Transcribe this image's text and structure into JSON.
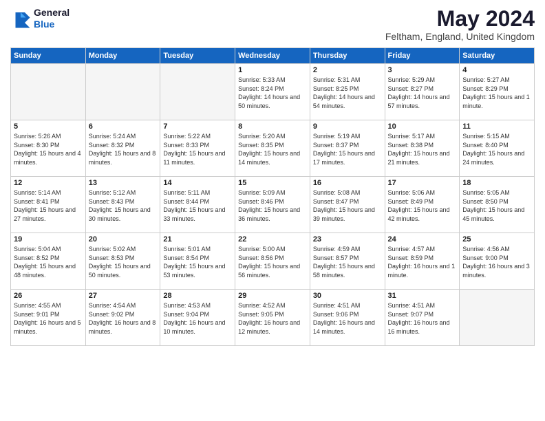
{
  "header": {
    "logo_line1": "General",
    "logo_line2": "Blue",
    "month": "May 2024",
    "location": "Feltham, England, United Kingdom"
  },
  "weekdays": [
    "Sunday",
    "Monday",
    "Tuesday",
    "Wednesday",
    "Thursday",
    "Friday",
    "Saturday"
  ],
  "weeks": [
    [
      {
        "day": "",
        "info": ""
      },
      {
        "day": "",
        "info": ""
      },
      {
        "day": "",
        "info": ""
      },
      {
        "day": "1",
        "info": "Sunrise: 5:33 AM\nSunset: 8:24 PM\nDaylight: 14 hours\nand 50 minutes."
      },
      {
        "day": "2",
        "info": "Sunrise: 5:31 AM\nSunset: 8:25 PM\nDaylight: 14 hours\nand 54 minutes."
      },
      {
        "day": "3",
        "info": "Sunrise: 5:29 AM\nSunset: 8:27 PM\nDaylight: 14 hours\nand 57 minutes."
      },
      {
        "day": "4",
        "info": "Sunrise: 5:27 AM\nSunset: 8:29 PM\nDaylight: 15 hours\nand 1 minute."
      }
    ],
    [
      {
        "day": "5",
        "info": "Sunrise: 5:26 AM\nSunset: 8:30 PM\nDaylight: 15 hours\nand 4 minutes."
      },
      {
        "day": "6",
        "info": "Sunrise: 5:24 AM\nSunset: 8:32 PM\nDaylight: 15 hours\nand 8 minutes."
      },
      {
        "day": "7",
        "info": "Sunrise: 5:22 AM\nSunset: 8:33 PM\nDaylight: 15 hours\nand 11 minutes."
      },
      {
        "day": "8",
        "info": "Sunrise: 5:20 AM\nSunset: 8:35 PM\nDaylight: 15 hours\nand 14 minutes."
      },
      {
        "day": "9",
        "info": "Sunrise: 5:19 AM\nSunset: 8:37 PM\nDaylight: 15 hours\nand 17 minutes."
      },
      {
        "day": "10",
        "info": "Sunrise: 5:17 AM\nSunset: 8:38 PM\nDaylight: 15 hours\nand 21 minutes."
      },
      {
        "day": "11",
        "info": "Sunrise: 5:15 AM\nSunset: 8:40 PM\nDaylight: 15 hours\nand 24 minutes."
      }
    ],
    [
      {
        "day": "12",
        "info": "Sunrise: 5:14 AM\nSunset: 8:41 PM\nDaylight: 15 hours\nand 27 minutes."
      },
      {
        "day": "13",
        "info": "Sunrise: 5:12 AM\nSunset: 8:43 PM\nDaylight: 15 hours\nand 30 minutes."
      },
      {
        "day": "14",
        "info": "Sunrise: 5:11 AM\nSunset: 8:44 PM\nDaylight: 15 hours\nand 33 minutes."
      },
      {
        "day": "15",
        "info": "Sunrise: 5:09 AM\nSunset: 8:46 PM\nDaylight: 15 hours\nand 36 minutes."
      },
      {
        "day": "16",
        "info": "Sunrise: 5:08 AM\nSunset: 8:47 PM\nDaylight: 15 hours\nand 39 minutes."
      },
      {
        "day": "17",
        "info": "Sunrise: 5:06 AM\nSunset: 8:49 PM\nDaylight: 15 hours\nand 42 minutes."
      },
      {
        "day": "18",
        "info": "Sunrise: 5:05 AM\nSunset: 8:50 PM\nDaylight: 15 hours\nand 45 minutes."
      }
    ],
    [
      {
        "day": "19",
        "info": "Sunrise: 5:04 AM\nSunset: 8:52 PM\nDaylight: 15 hours\nand 48 minutes."
      },
      {
        "day": "20",
        "info": "Sunrise: 5:02 AM\nSunset: 8:53 PM\nDaylight: 15 hours\nand 50 minutes."
      },
      {
        "day": "21",
        "info": "Sunrise: 5:01 AM\nSunset: 8:54 PM\nDaylight: 15 hours\nand 53 minutes."
      },
      {
        "day": "22",
        "info": "Sunrise: 5:00 AM\nSunset: 8:56 PM\nDaylight: 15 hours\nand 56 minutes."
      },
      {
        "day": "23",
        "info": "Sunrise: 4:59 AM\nSunset: 8:57 PM\nDaylight: 15 hours\nand 58 minutes."
      },
      {
        "day": "24",
        "info": "Sunrise: 4:57 AM\nSunset: 8:59 PM\nDaylight: 16 hours\nand 1 minute."
      },
      {
        "day": "25",
        "info": "Sunrise: 4:56 AM\nSunset: 9:00 PM\nDaylight: 16 hours\nand 3 minutes."
      }
    ],
    [
      {
        "day": "26",
        "info": "Sunrise: 4:55 AM\nSunset: 9:01 PM\nDaylight: 16 hours\nand 5 minutes."
      },
      {
        "day": "27",
        "info": "Sunrise: 4:54 AM\nSunset: 9:02 PM\nDaylight: 16 hours\nand 8 minutes."
      },
      {
        "day": "28",
        "info": "Sunrise: 4:53 AM\nSunset: 9:04 PM\nDaylight: 16 hours\nand 10 minutes."
      },
      {
        "day": "29",
        "info": "Sunrise: 4:52 AM\nSunset: 9:05 PM\nDaylight: 16 hours\nand 12 minutes."
      },
      {
        "day": "30",
        "info": "Sunrise: 4:51 AM\nSunset: 9:06 PM\nDaylight: 16 hours\nand 14 minutes."
      },
      {
        "day": "31",
        "info": "Sunrise: 4:51 AM\nSunset: 9:07 PM\nDaylight: 16 hours\nand 16 minutes."
      },
      {
        "day": "",
        "info": ""
      }
    ]
  ]
}
